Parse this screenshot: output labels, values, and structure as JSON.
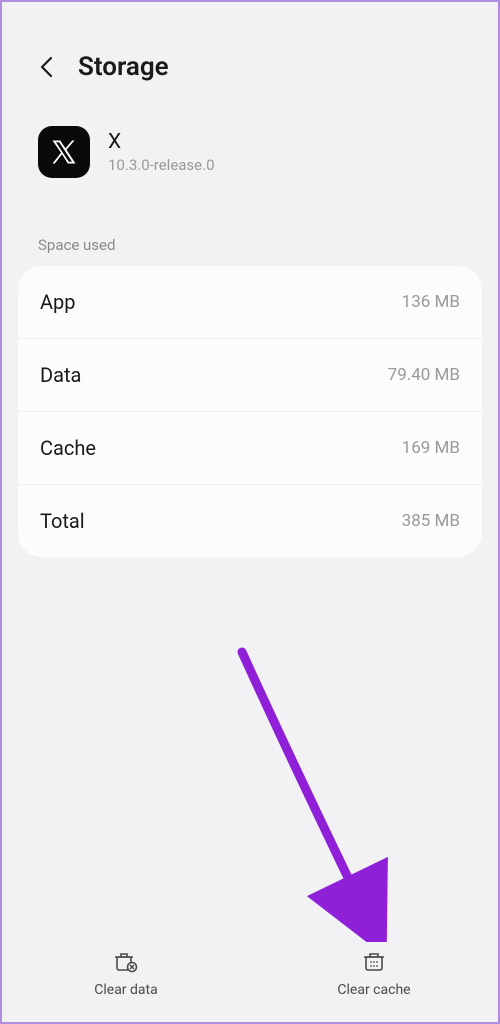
{
  "header": {
    "title": "Storage"
  },
  "app": {
    "name": "X",
    "version": "10.3.0-release.0"
  },
  "section": {
    "label": "Space used"
  },
  "rows": [
    {
      "label": "App",
      "value": "136 MB"
    },
    {
      "label": "Data",
      "value": "79.40 MB"
    },
    {
      "label": "Cache",
      "value": "169 MB"
    },
    {
      "label": "Total",
      "value": "385 MB"
    }
  ],
  "actions": {
    "clear_data": "Clear data",
    "clear_cache": "Clear cache"
  }
}
